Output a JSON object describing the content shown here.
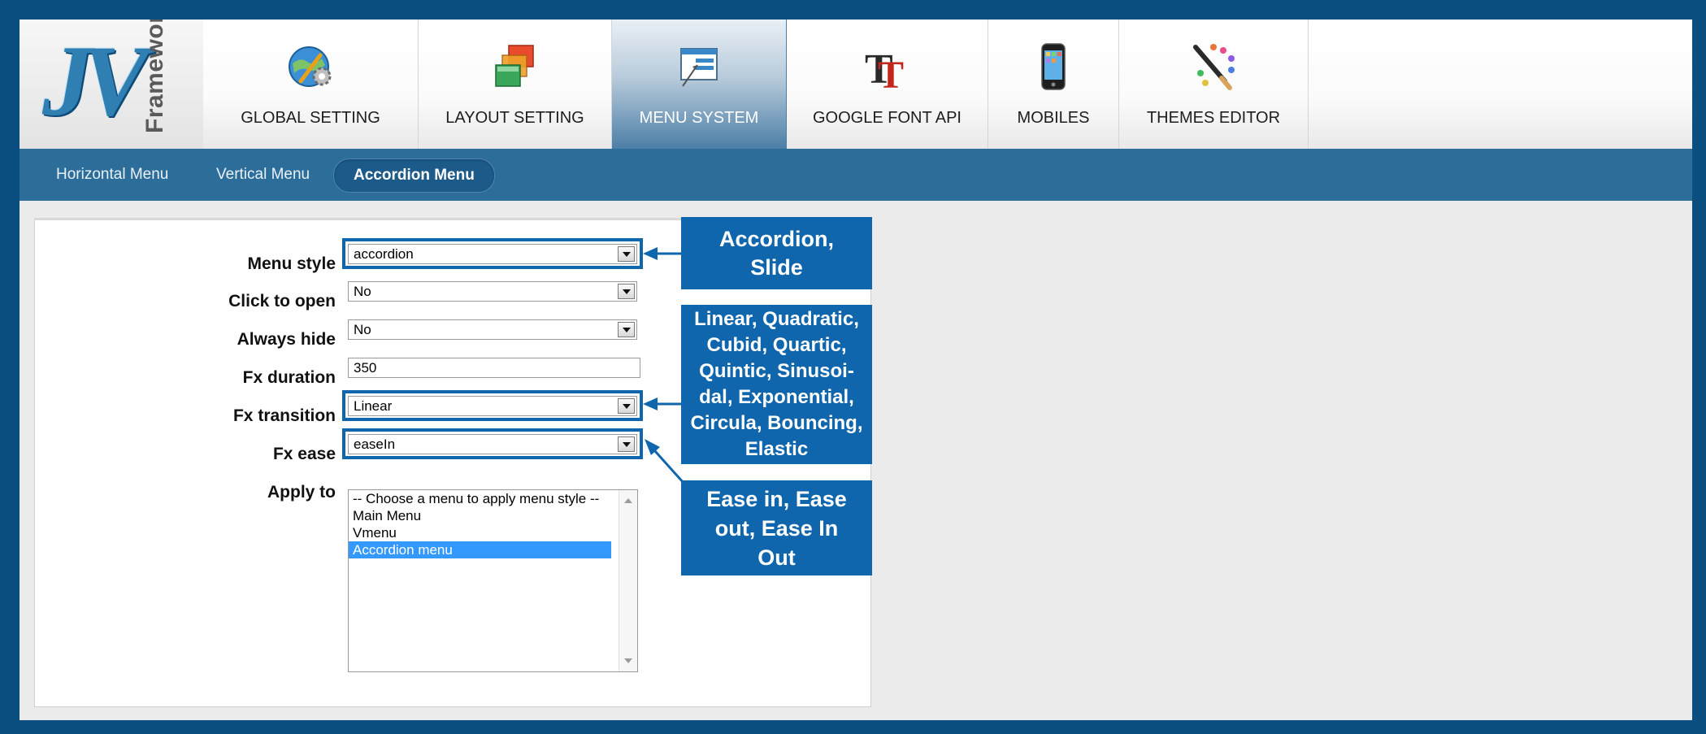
{
  "logo": {
    "main_text": "JV",
    "side_text": "Framework"
  },
  "tabs": [
    {
      "label": "GLOBAL SETTING",
      "icon": "globe-gear-icon",
      "active": false
    },
    {
      "label": "LAYOUT SETTING",
      "icon": "stacked-layers-icon",
      "active": false
    },
    {
      "label": "MENU SYSTEM",
      "icon": "menu-window-icon",
      "active": true
    },
    {
      "label": "GOOGLE FONT API",
      "icon": "font-tt-icon",
      "active": false
    },
    {
      "label": "MOBILES",
      "icon": "mobile-phone-icon",
      "active": false
    },
    {
      "label": "THEMES EDITOR",
      "icon": "palette-brush-icon",
      "active": false
    }
  ],
  "subnav": {
    "items": [
      {
        "label": "Horizontal Menu",
        "active": false
      },
      {
        "label": "Vertical Menu",
        "active": false
      },
      {
        "label": "Accordion Menu",
        "active": true
      }
    ]
  },
  "form": {
    "menu_style": {
      "label": "Menu style",
      "value": "accordion"
    },
    "click_to_open": {
      "label": "Click to open",
      "value": "No"
    },
    "always_hide": {
      "label": "Always hide",
      "value": "No"
    },
    "fx_duration": {
      "label": "Fx duration",
      "value": "350"
    },
    "fx_transition": {
      "label": "Fx transition",
      "value": "Linear"
    },
    "fx_ease": {
      "label": "Fx ease",
      "value": "easeIn"
    },
    "apply_to": {
      "label": "Apply to",
      "options": [
        {
          "label": "-- Choose a menu to apply menu style --",
          "selected": false
        },
        {
          "label": "Main Menu",
          "selected": false
        },
        {
          "label": "Vmenu",
          "selected": false
        },
        {
          "label": "Accordion menu",
          "selected": true
        }
      ]
    }
  },
  "callouts": {
    "menu_style": "Accordion,\nSlide",
    "fx_transition": "Linear, Quadratic,\nCubid, Quartic,\nQuintic, Sinusoi-\ndal, Exponential,\nCircula, Bouncing,\nElastic",
    "fx_ease": "Ease in, Ease\nout, Ease In\nOut"
  },
  "colors": {
    "outer_border": "#0b4e80",
    "subnav_bar": "#2d6d9a",
    "callout_bg": "#0f66ad",
    "highlight_border": "#0f66ad",
    "selected_option": "#3399ff"
  }
}
